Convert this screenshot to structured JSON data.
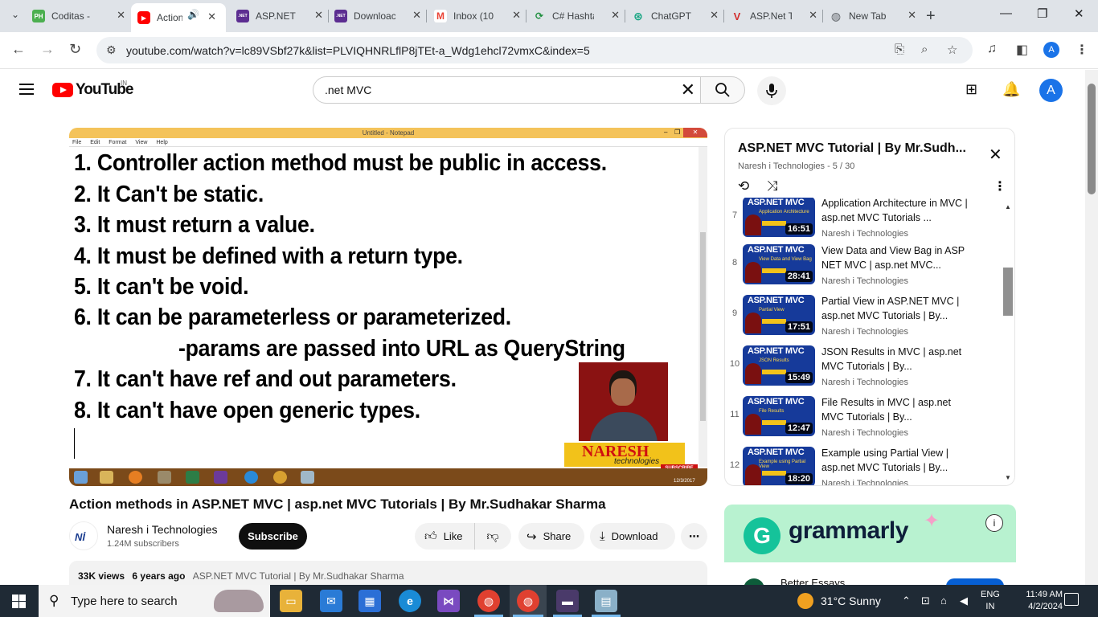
{
  "browser": {
    "tabs": [
      {
        "label": "Coditas -",
        "favicon": "PH",
        "color": "#4caf50"
      },
      {
        "label": "Action",
        "favicon": "yt",
        "color": "#ff0000"
      },
      {
        "label": "ASP.NET I",
        "favicon": ".NET",
        "color": "#5c2d91"
      },
      {
        "label": "Downloac",
        "favicon": ".NET",
        "color": "#5c2d91"
      },
      {
        "label": "Inbox (10",
        "favicon": "M",
        "color": "#ea4335"
      },
      {
        "label": "C# Hashta",
        "favicon": "G",
        "color": "#1e8e3e"
      },
      {
        "label": "ChatGPT",
        "favicon": "⊛",
        "color": "#10a37f"
      },
      {
        "label": "ASP.Net T",
        "favicon": "V",
        "color": "#d32f2f"
      },
      {
        "label": "New Tab",
        "favicon": "◍",
        "color": "#5f6368"
      }
    ],
    "url": "youtube.com/watch?v=lc89VSbf27k&list=PLVIQHNRLflP8jTEt-a_Wdg1ehcl72vmxC&index=5",
    "profile_initial": "A"
  },
  "youtube": {
    "logo_text": "YouTube",
    "region": "IN",
    "search_value": ".net MVC",
    "avatar_initial": "A"
  },
  "player": {
    "notepad_title": "Untitled - Notepad",
    "notepad_menu": [
      "File",
      "Edit",
      "Format",
      "View",
      "Help"
    ],
    "lines": [
      "1. Controller action method must be public in access.",
      "2. It Can't be static.",
      "3. It must return a value.",
      "4. It must be defined with a return type.",
      "5. It can't be void.",
      "6. It can be parameterless or parameterized.",
      "        -params are passed into URL as QueryString",
      "7. It can't have ref and out parameters.",
      "8. It can't have open generic types."
    ],
    "brand": "NARESH",
    "brand_sub": "technologies",
    "subscribe_badge": "SUBSCRIBE NOW",
    "overlay_date": "12/3/2017"
  },
  "video": {
    "title": "Action methods in ASP.NET MVC | asp.net MVC Tutorials | By Mr.Sudhakar Sharma",
    "channel": "Naresh i Technologies",
    "subscribers": "1.24M subscribers",
    "subscribe_label": "Subscribe",
    "like_label": "Like",
    "share_label": "Share",
    "download_label": "Download",
    "views": "33K views",
    "age": "6 years ago",
    "playlist_link": "ASP.NET MVC Tutorial | By Mr.Sudhakar Sharma"
  },
  "playlist": {
    "title": "ASP.NET MVC Tutorial | By Mr.Sudh...",
    "subtitle": "Naresh i Technologies - 5 / 30",
    "items": [
      {
        "index": "7",
        "title": "Application Architecture in MVC | asp.net MVC Tutorials ...",
        "channel": "Naresh i Technologies",
        "duration": "16:51",
        "thumb_title": "ASP.NET MVC",
        "thumb_sub": "Application Architecture"
      },
      {
        "index": "8",
        "title": "View Data and View Bag in ASP NET MVC | asp.net MVC...",
        "channel": "Naresh i Technologies",
        "duration": "28:41",
        "thumb_title": "ASP.NET MVC",
        "thumb_sub": "View Data and View Bag"
      },
      {
        "index": "9",
        "title": "Partial View in ASP.NET MVC | asp.net MVC Tutorials | By...",
        "channel": "Naresh i Technologies",
        "duration": "17:51",
        "thumb_title": "ASP.NET MVC",
        "thumb_sub": "Partial View"
      },
      {
        "index": "10",
        "title": "JSON Results in MVC | asp.net MVC Tutorials | By...",
        "channel": "Naresh i Technologies",
        "duration": "15:49",
        "thumb_title": "ASP.NET MVC",
        "thumb_sub": "JSON Results"
      },
      {
        "index": "11",
        "title": "File Results in MVC | asp.net MVC Tutorials | By...",
        "channel": "Naresh i Technologies",
        "duration": "12:47",
        "thumb_title": "ASP.NET MVC",
        "thumb_sub": "File Results"
      },
      {
        "index": "12",
        "title": "Example using Partial View | asp.net MVC Tutorials | By...",
        "channel": "Naresh i Technologies",
        "duration": "18:20",
        "thumb_title": "ASP.NET MVC",
        "thumb_sub": "Example using Partial View"
      }
    ]
  },
  "ad": {
    "brand": "grammarly",
    "headline": "Better Essays"
  },
  "taskbar": {
    "search_placeholder": "Type here to search",
    "weather": "31°C  Sunny",
    "language": [
      "ENG",
      "IN"
    ],
    "time": "11:49 AM",
    "date": "4/2/2024"
  },
  "colors": {
    "youtube_red": "#ff0000",
    "accent_blue": "#1a73e8",
    "notepad_titlebar": "#f4c35a",
    "playlist_thumb_bg": "#163a9a",
    "taskbar_bg": "#1f2a35"
  }
}
